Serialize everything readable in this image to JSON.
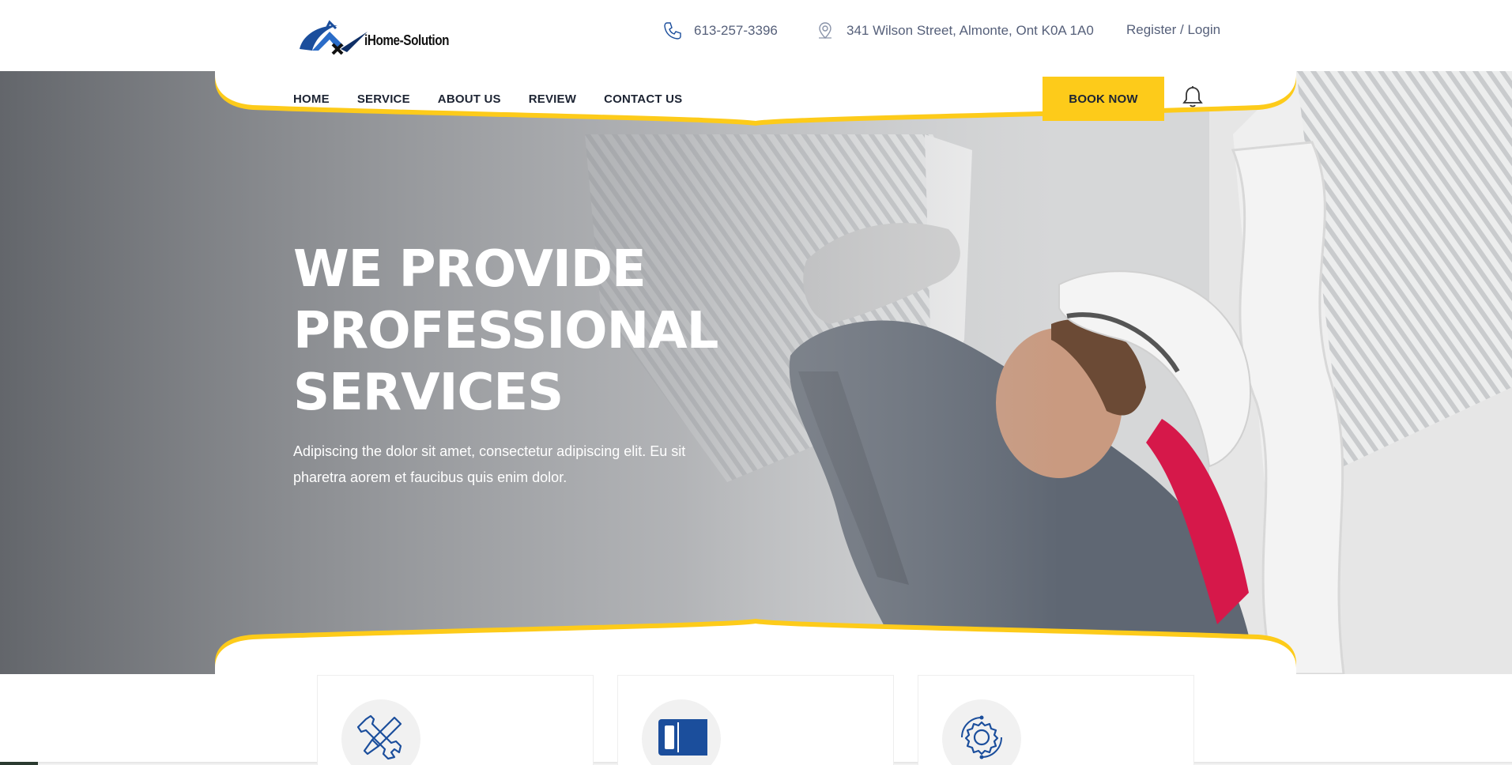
{
  "brand": {
    "name": "iHome-Solution"
  },
  "contact": {
    "phone": "613-257-3396",
    "address": "341 Wilson Street, Almonte, Ont K0A 1A0",
    "auth_label": "Register / Login"
  },
  "nav": {
    "items": [
      {
        "label": "HOME"
      },
      {
        "label": "SERVICE"
      },
      {
        "label": "ABOUT US"
      },
      {
        "label": "REVIEW"
      },
      {
        "label": "CONTACT US"
      }
    ],
    "book_label": "BOOK NOW"
  },
  "hero": {
    "title_lines": [
      "WE PROVIDE",
      "PROFESSIONAL",
      "SERVICES"
    ],
    "description": "Adipiscing the dolor sit amet, consectetur adipiscing elit. Eu sit pharetra aorem et faucibus quis enim dolor."
  },
  "services": {
    "cards": [
      {
        "icon": "tools-icon"
      },
      {
        "icon": "panel-icon"
      },
      {
        "icon": "gear-icon"
      }
    ]
  },
  "colors": {
    "accent": "#fdcb1a",
    "brand_blue": "#1b4e9c",
    "text_dark": "#1d2433",
    "text_muted": "#56607a"
  }
}
